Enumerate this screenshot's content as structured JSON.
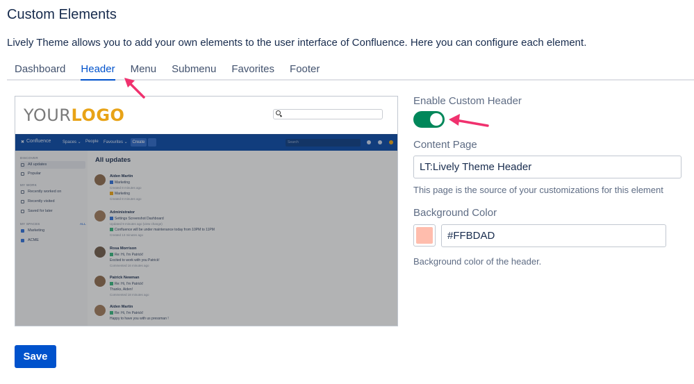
{
  "page": {
    "title": "Custom Elements",
    "description": "Lively Theme allows you to add your own elements to the user interface of Confluence. Here you can configure each element."
  },
  "tabs": [
    {
      "label": "Dashboard",
      "active": false
    },
    {
      "label": "Header",
      "active": true
    },
    {
      "label": "Menu",
      "active": false
    },
    {
      "label": "Submenu",
      "active": false
    },
    {
      "label": "Favorites",
      "active": false
    },
    {
      "label": "Footer",
      "active": false
    }
  ],
  "preview": {
    "logo_part1": "YOUR",
    "logo_part2": "LOGO",
    "nav": {
      "brand": "Confluence",
      "items": [
        "Spaces ⌄",
        "People",
        "Favourites ⌄"
      ],
      "create": "Create",
      "search_placeholder": "Search"
    },
    "sidebar": {
      "discover_heading": "DISCOVER",
      "discover_items": [
        "All updates",
        "Popular"
      ],
      "mywork_heading": "MY WORK",
      "mywork_items": [
        "Recently worked on",
        "Recently visited",
        "Saved for later"
      ],
      "spaces_heading": "MY SPACES",
      "spaces_all": "ALL",
      "spaces_items": [
        "Marketing",
        "ACME"
      ]
    },
    "main_title": "All updates",
    "feed": [
      {
        "name": "Aiden Martin",
        "lines": [
          "Marketing",
          "Marketing"
        ],
        "subs": [
          "Created 8 minutes ago",
          "Created 8 minutes ago"
        ]
      },
      {
        "name": "Administrator",
        "lines": [
          "Settings Screenshot Dashboard",
          "Confluence will be under maintenance today from 10PM to 11PM"
        ],
        "subs": [
          "Updated 9 minutes ago (view change)",
          "Created 13 minutes ago"
        ]
      },
      {
        "name": "Rosa Morrison",
        "lines": [
          "Re: Hi, I'm Patrick!",
          "Excited to work with you Patrick!"
        ],
        "subs": [
          "Commented 16 minutes ago"
        ]
      },
      {
        "name": "Patrick Newman",
        "lines": [
          "Re: Hi, I'm Patrick!",
          "Thanks, Aiden!"
        ],
        "subs": [
          "Commented 18 minutes ago"
        ]
      },
      {
        "name": "Aiden Martin",
        "lines": [
          "Re: Hi, I'm Patrick!",
          "Happy to have you with us pressman !"
        ],
        "subs": []
      }
    ]
  },
  "form": {
    "enable_label": "Enable Custom Header",
    "enabled": true,
    "content_page_label": "Content Page",
    "content_page_value": "LT:Lively Theme Header",
    "content_page_help": "This page is the source of your customizations for this element",
    "bg_color_label": "Background Color",
    "bg_color_value": "#FFBDAD",
    "bg_color_help": "Background color of the header."
  },
  "save_label": "Save",
  "colors": {
    "accent": "#0052CC",
    "toggle_on": "#00875A",
    "swatch": "#FFBDAD",
    "annotation_arrow": "#F0316E"
  }
}
